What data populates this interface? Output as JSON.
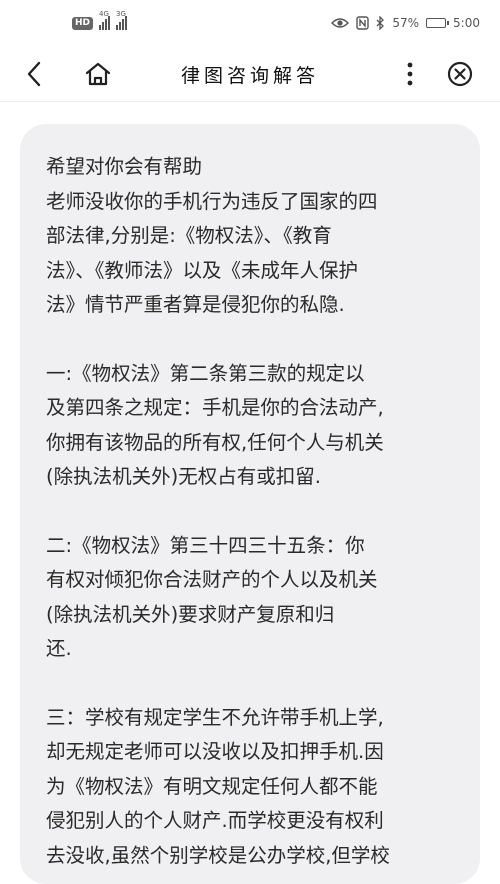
{
  "status_bar": {
    "hd": "HD",
    "signal1_label": "4G",
    "signal2_label": "3G",
    "battery_text": "57%",
    "time": "5:00"
  },
  "header": {
    "title": "律图咨询解答"
  },
  "message": {
    "paragraphs": [
      [
        "希望对你会有帮助",
        "老师没收你的手机行为违反了国家的四",
        "部法律,分别是:《物权法》、《教育",
        "法》、《教师法》以及《未成年人保护",
        "法》情节严重者算是侵犯你的私隐."
      ],
      [
        "一:《物权法》第二条第三款的规定以",
        "及第四条之规定：手机是你的合法动产,",
        "你拥有该物品的所有权,任何个人与机关",
        "(除执法机关外)无权占有或扣留."
      ],
      [
        "二:《物权法》第三十四三十五条：你",
        "有权对倾犯你合法财产的个人以及机关",
        "(除执法机关外)要求财产复原和归",
        "还."
      ],
      [
        "三：学校有规定学生不允许带手机上学,",
        "却无规定老师可以没收以及扣押手机.因",
        "为《物权法》有明文规定任何人都不能",
        "侵犯别人的个人财产.而学校更没有权利",
        "去没收,虽然个别学校是公办学校,但学校"
      ]
    ]
  }
}
